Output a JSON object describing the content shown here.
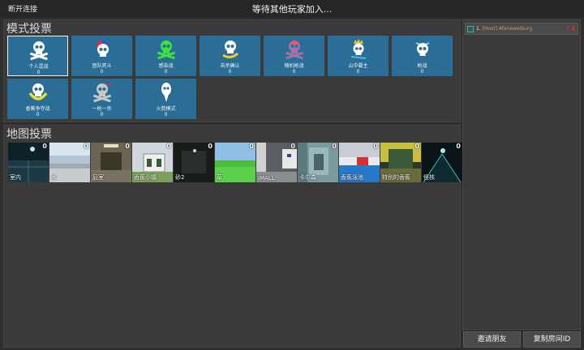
{
  "top_bar": {
    "disconnect_label": "断开连接",
    "waiting_text": "等待其他玩家加入..."
  },
  "mode_vote": {
    "title": "模式投票",
    "modes": [
      {
        "name": "个人混战",
        "count": "0",
        "icon": "skull-crossbones-icon",
        "selected": true
      },
      {
        "name": "团队死斗",
        "count": "0",
        "icon": "skull-red-blue-icon"
      },
      {
        "name": "感染战",
        "count": "0",
        "icon": "skull-green-icon"
      },
      {
        "name": "击杀确认",
        "count": "0",
        "icon": "skull-yellow-icon"
      },
      {
        "name": "随机枪战",
        "count": "0",
        "icon": "skull-gradient-icon"
      },
      {
        "name": "山中霸主",
        "count": "0",
        "icon": "skull-crown-icon"
      },
      {
        "name": "枪战",
        "count": "0",
        "icon": "skull-gun-icon"
      },
      {
        "name": "香蕉争夺战",
        "count": "0",
        "icon": "skull-banana-icon"
      },
      {
        "name": "一枪一杀",
        "count": "0",
        "icon": "skull-crosshair-icon"
      },
      {
        "name": "火箭模式",
        "count": "0",
        "icon": "rocket-skull-icon"
      }
    ]
  },
  "map_vote": {
    "title": "地图投票",
    "maps": [
      {
        "name": "室内",
        "count": "0"
      },
      {
        "name": "水",
        "count": "0"
      },
      {
        "name": "后室",
        "count": "0"
      },
      {
        "name": "香蕉小镇",
        "count": "0"
      },
      {
        "name": "砂2",
        "count": "0"
      },
      {
        "name": "草",
        "count": "0"
      },
      {
        "name": "IMALL",
        "count": "0"
      },
      {
        "name": "卡尔森",
        "count": "0"
      },
      {
        "name": "香蕉泳池",
        "count": "0"
      },
      {
        "name": "特别的香蕉",
        "count": "0"
      },
      {
        "name": "怪核",
        "count": "0"
      }
    ]
  },
  "players": {
    "list": [
      {
        "number": "1.",
        "name": "[Host] Afaneweiburg"
      }
    ]
  },
  "buttons": {
    "invite_label": "邀请朋友",
    "copy_room_label": "复制房间ID"
  },
  "colors": {
    "background": "#2e2e2e",
    "panel": "#3a3a3a",
    "mode_tile": "#2a6e98",
    "host_name": "#b8a266"
  }
}
